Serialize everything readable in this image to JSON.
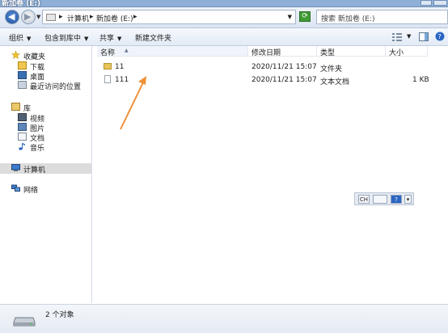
{
  "window": {
    "title": "新加卷 (E:)"
  },
  "address": {
    "crumbs": [
      "计算机",
      "新加卷 (E:)"
    ],
    "search_placeholder": "搜索 新加卷 (E:)"
  },
  "toolbar": {
    "organize": "组织",
    "include_in_library": "包含到库中",
    "share": "共享",
    "new_folder": "新建文件夹"
  },
  "nav": {
    "favorites": "收藏夹",
    "downloads": "下载",
    "desktop": "桌面",
    "recent": "最近访问的位置",
    "libraries": "库",
    "videos": "视频",
    "pictures": "图片",
    "documents": "文档",
    "music": "音乐",
    "computer": "计算机",
    "network": "网络"
  },
  "columns": {
    "name": "名称",
    "modified": "修改日期",
    "type": "类型",
    "size": "大小"
  },
  "files": [
    {
      "name": "11",
      "modified": "2020/11/21 15:07",
      "type": "文件夹",
      "size": ""
    },
    {
      "name": "111",
      "modified": "2020/11/21 15:07",
      "type": "文本文档",
      "size": "1 KB"
    }
  ],
  "ime": {
    "label": "CH"
  },
  "status": {
    "text": "2 个对象"
  },
  "colors": {
    "selection": "#dcdcdc",
    "arrow": "#f0913a",
    "accent": "#1c4f9c"
  }
}
